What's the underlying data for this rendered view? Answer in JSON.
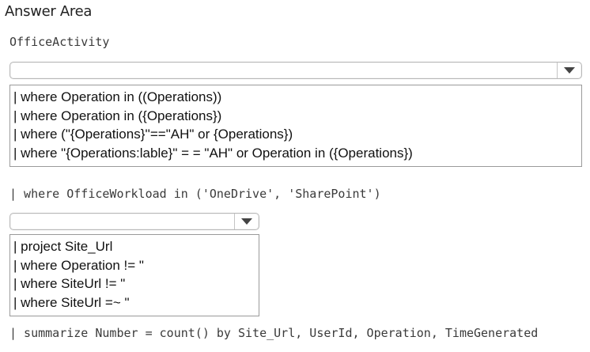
{
  "title": "Answer Area",
  "query": {
    "table": "OfficeActivity",
    "workload_filter": "| where OfficeWorkload in ('OneDrive', 'SharePoint')",
    "summarize": "| summarize Number = count() by Site_Url, UserId, Operation, TimeGenerated"
  },
  "dropdown1": {
    "selected": "",
    "options": [
      "| where Operation in ((Operations))",
      "| where Operation in ({Operations})",
      "| where (\"{Operations}''==\"AH\" or {Operations})",
      "| where \"{Operations:lable}\" = = \"AH\" or Operation in ({Operations})"
    ]
  },
  "dropdown2": {
    "selected": "",
    "options": [
      "| project Site_Url",
      "| where Operation != \"",
      "| where SiteUrl != \"",
      "| where SiteUrl =~ \""
    ]
  },
  "icons": {
    "dropdown_arrow": "chevron-down-icon"
  }
}
